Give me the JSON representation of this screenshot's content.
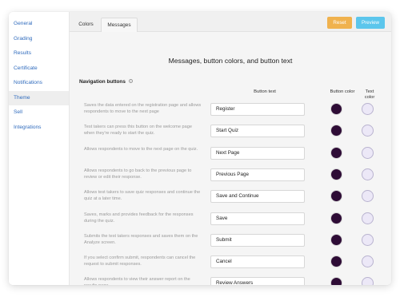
{
  "sidebar": {
    "items": [
      {
        "label": "General"
      },
      {
        "label": "Grading"
      },
      {
        "label": "Results"
      },
      {
        "label": "Certificate"
      },
      {
        "label": "Notifications"
      },
      {
        "label": "Theme",
        "active": true
      },
      {
        "label": "Sell"
      },
      {
        "label": "Integrations"
      }
    ]
  },
  "tabs": {
    "colors": "Colors",
    "messages": "Messages"
  },
  "toolbar": {
    "reset_label": "Reset",
    "preview_label": "Preview"
  },
  "page": {
    "title": "Messages, button colors, and button text",
    "section_label": "Navigation buttons",
    "info_icon_glyph": "i"
  },
  "columns": {
    "button_text": "Button text",
    "button_color": "Button color",
    "text_color_line1": "Text",
    "text_color_line2": "color"
  },
  "colors": {
    "button_color": "#2e0c36",
    "text_color": "#ece8f7",
    "reset": "#f0b24e",
    "preview": "#5cc6ec",
    "link": "#2f6bbd"
  },
  "rows": [
    {
      "desc": "Saves the data entered on the registration page and allows respondents to move to the next page",
      "value": "Register"
    },
    {
      "desc": "Test takers can press this button on the welcome page when they're ready to start the quiz.",
      "value": "Start Quiz"
    },
    {
      "desc": "Allows respondents to move to the next page on the quiz.",
      "value": "Next Page"
    },
    {
      "desc": "Allows respondents to go back to the previous page to review or edit their response.",
      "value": "Previous Page"
    },
    {
      "desc": "Allows test takers to save quiz responses and continue the quiz at a later time.",
      "value": "Save and Continue"
    },
    {
      "desc": "Saves, marks and provides feedback for the responses during the quiz.",
      "value": "Save"
    },
    {
      "desc": "Submits the test takers responses and saves them on the Analyze screen.",
      "value": "Submit"
    },
    {
      "desc": "If you select confirm submit, respondents can cancel the request to submit responses.",
      "value": "Cancel"
    },
    {
      "desc": "Allows respondents to view their answer report on the results page.",
      "value": "Review Answers"
    }
  ]
}
